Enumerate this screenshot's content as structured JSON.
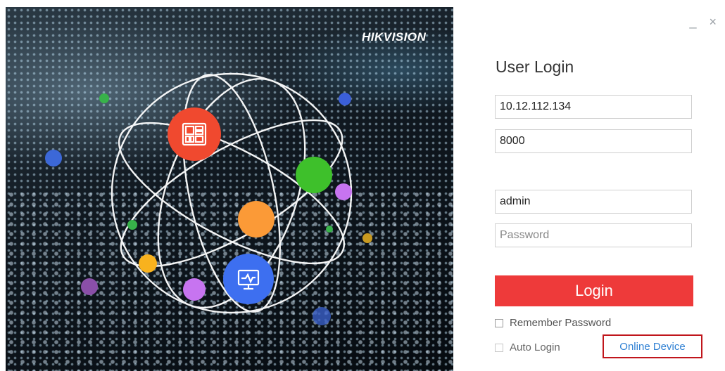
{
  "brand": {
    "logo_text": "HIKVISION"
  },
  "window_controls": {
    "minimize": "_",
    "close": "×"
  },
  "login": {
    "title": "User Login",
    "server_address": "10.12.112.134",
    "port": "8000",
    "username": "admin",
    "password_placeholder": "Password",
    "submit_label": "Login",
    "remember_password_label": "Remember Password",
    "auto_login_label": "Auto Login",
    "online_device_label": "Online Device"
  },
  "colors": {
    "login_button": "#ee3a3a",
    "link": "#2d7fd3",
    "highlight_border": "#c0161c"
  },
  "icons": {
    "top_node": "grid-layout-icon",
    "bottom_node": "monitor-icon"
  }
}
